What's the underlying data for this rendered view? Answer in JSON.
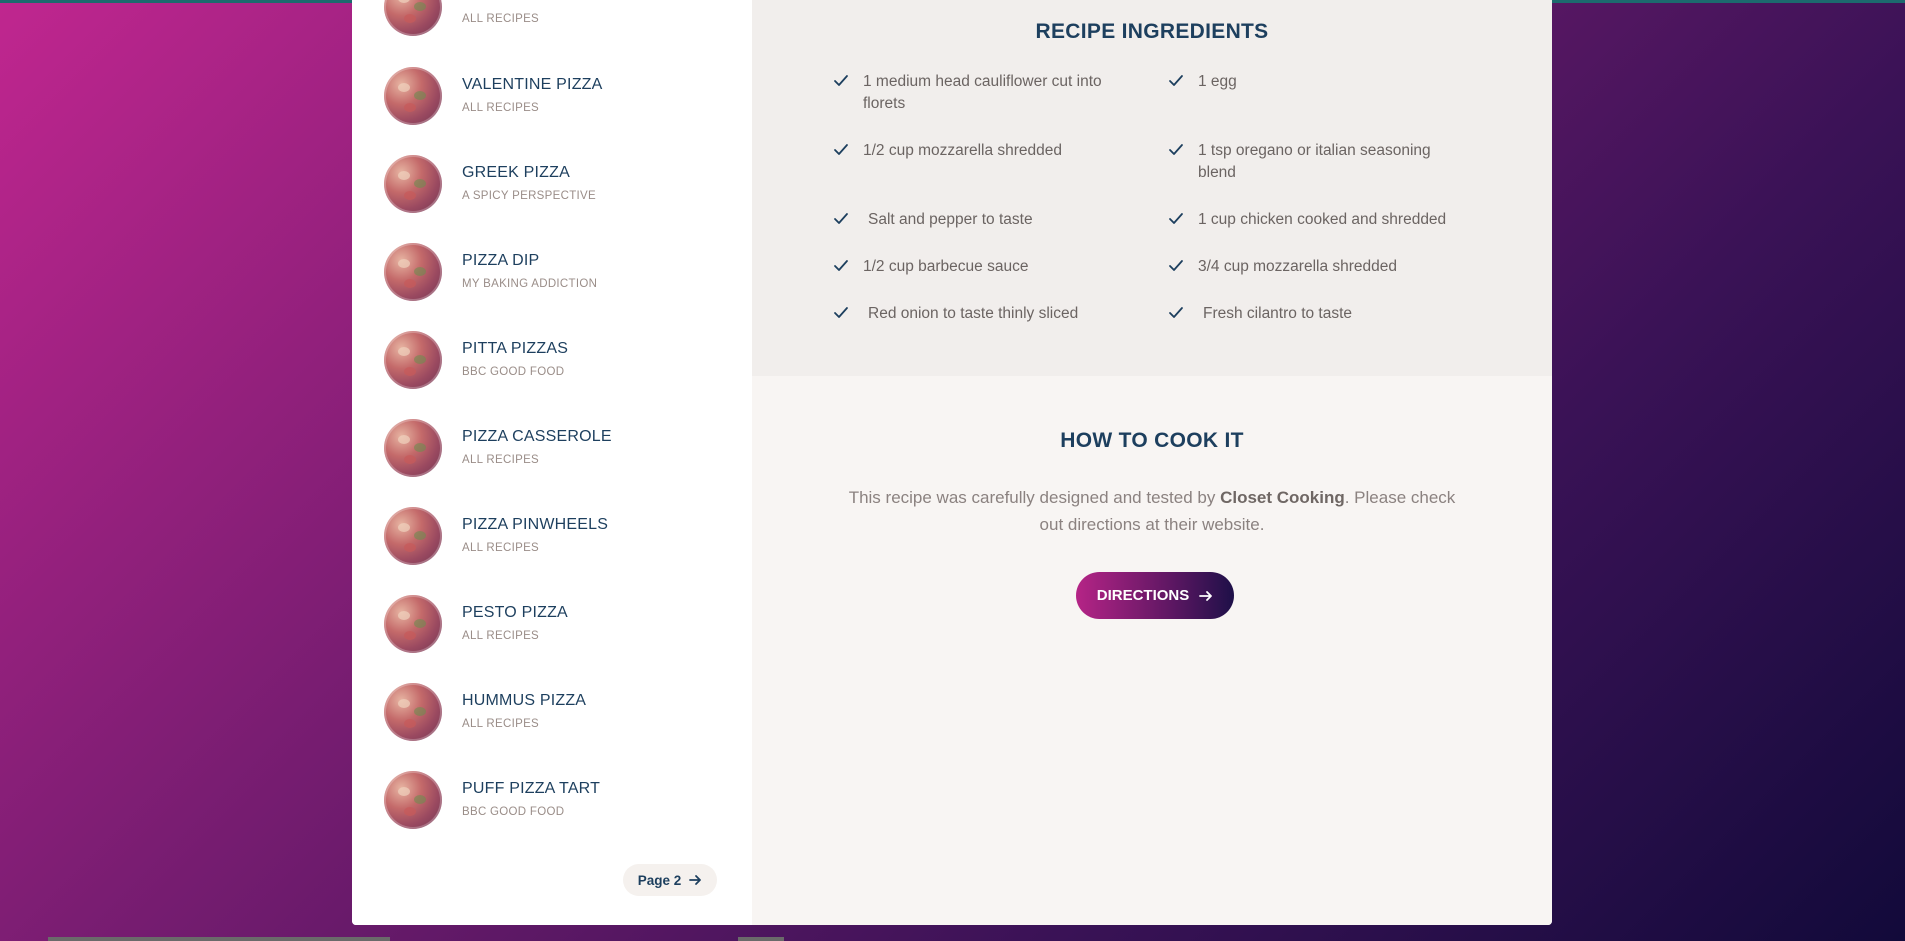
{
  "sidebar": {
    "items": [
      {
        "title": "",
        "source": "ALL RECIPES"
      },
      {
        "title": "VALENTINE PIZZA",
        "source": "ALL RECIPES"
      },
      {
        "title": "GREEK PIZZA",
        "source": "A SPICY PERSPECTIVE"
      },
      {
        "title": "PIZZA DIP",
        "source": "MY BAKING ADDICTION"
      },
      {
        "title": "PITTA PIZZAS",
        "source": "BBC GOOD FOOD"
      },
      {
        "title": "PIZZA CASSEROLE",
        "source": "ALL RECIPES"
      },
      {
        "title": "PIZZA PINWHEELS",
        "source": "ALL RECIPES"
      },
      {
        "title": "PESTO PIZZA",
        "source": "ALL RECIPES"
      },
      {
        "title": "HUMMUS PIZZA",
        "source": "ALL RECIPES"
      },
      {
        "title": "PUFF PIZZA TART",
        "source": "BBC GOOD FOOD"
      }
    ],
    "page_button": "Page 2"
  },
  "ingredients": {
    "title": "RECIPE INGREDIENTS",
    "items": [
      "1 medium head cauliflower cut into florets",
      "1 egg",
      "1/2 cup mozzarella shredded",
      "1 tsp oregano or italian seasoning blend",
      "Salt and pepper to taste",
      "1 cup chicken cooked and shredded",
      "1/2 cup barbecue sauce",
      "3/4 cup mozzarella shredded",
      "Red onion to taste thinly sliced",
      "Fresh cilantro to taste"
    ]
  },
  "how_to": {
    "title": "HOW TO COOK IT",
    "text_before": "This recipe was carefully designed and tested by ",
    "author": "Closet Cooking",
    "text_after": ". Please check out directions at their website.",
    "button": "DIRECTIONS"
  },
  "colors": {
    "accent_navy": "#1d3f5e",
    "button_gradient_start": "#b52486",
    "button_gradient_end": "#1e1048"
  }
}
